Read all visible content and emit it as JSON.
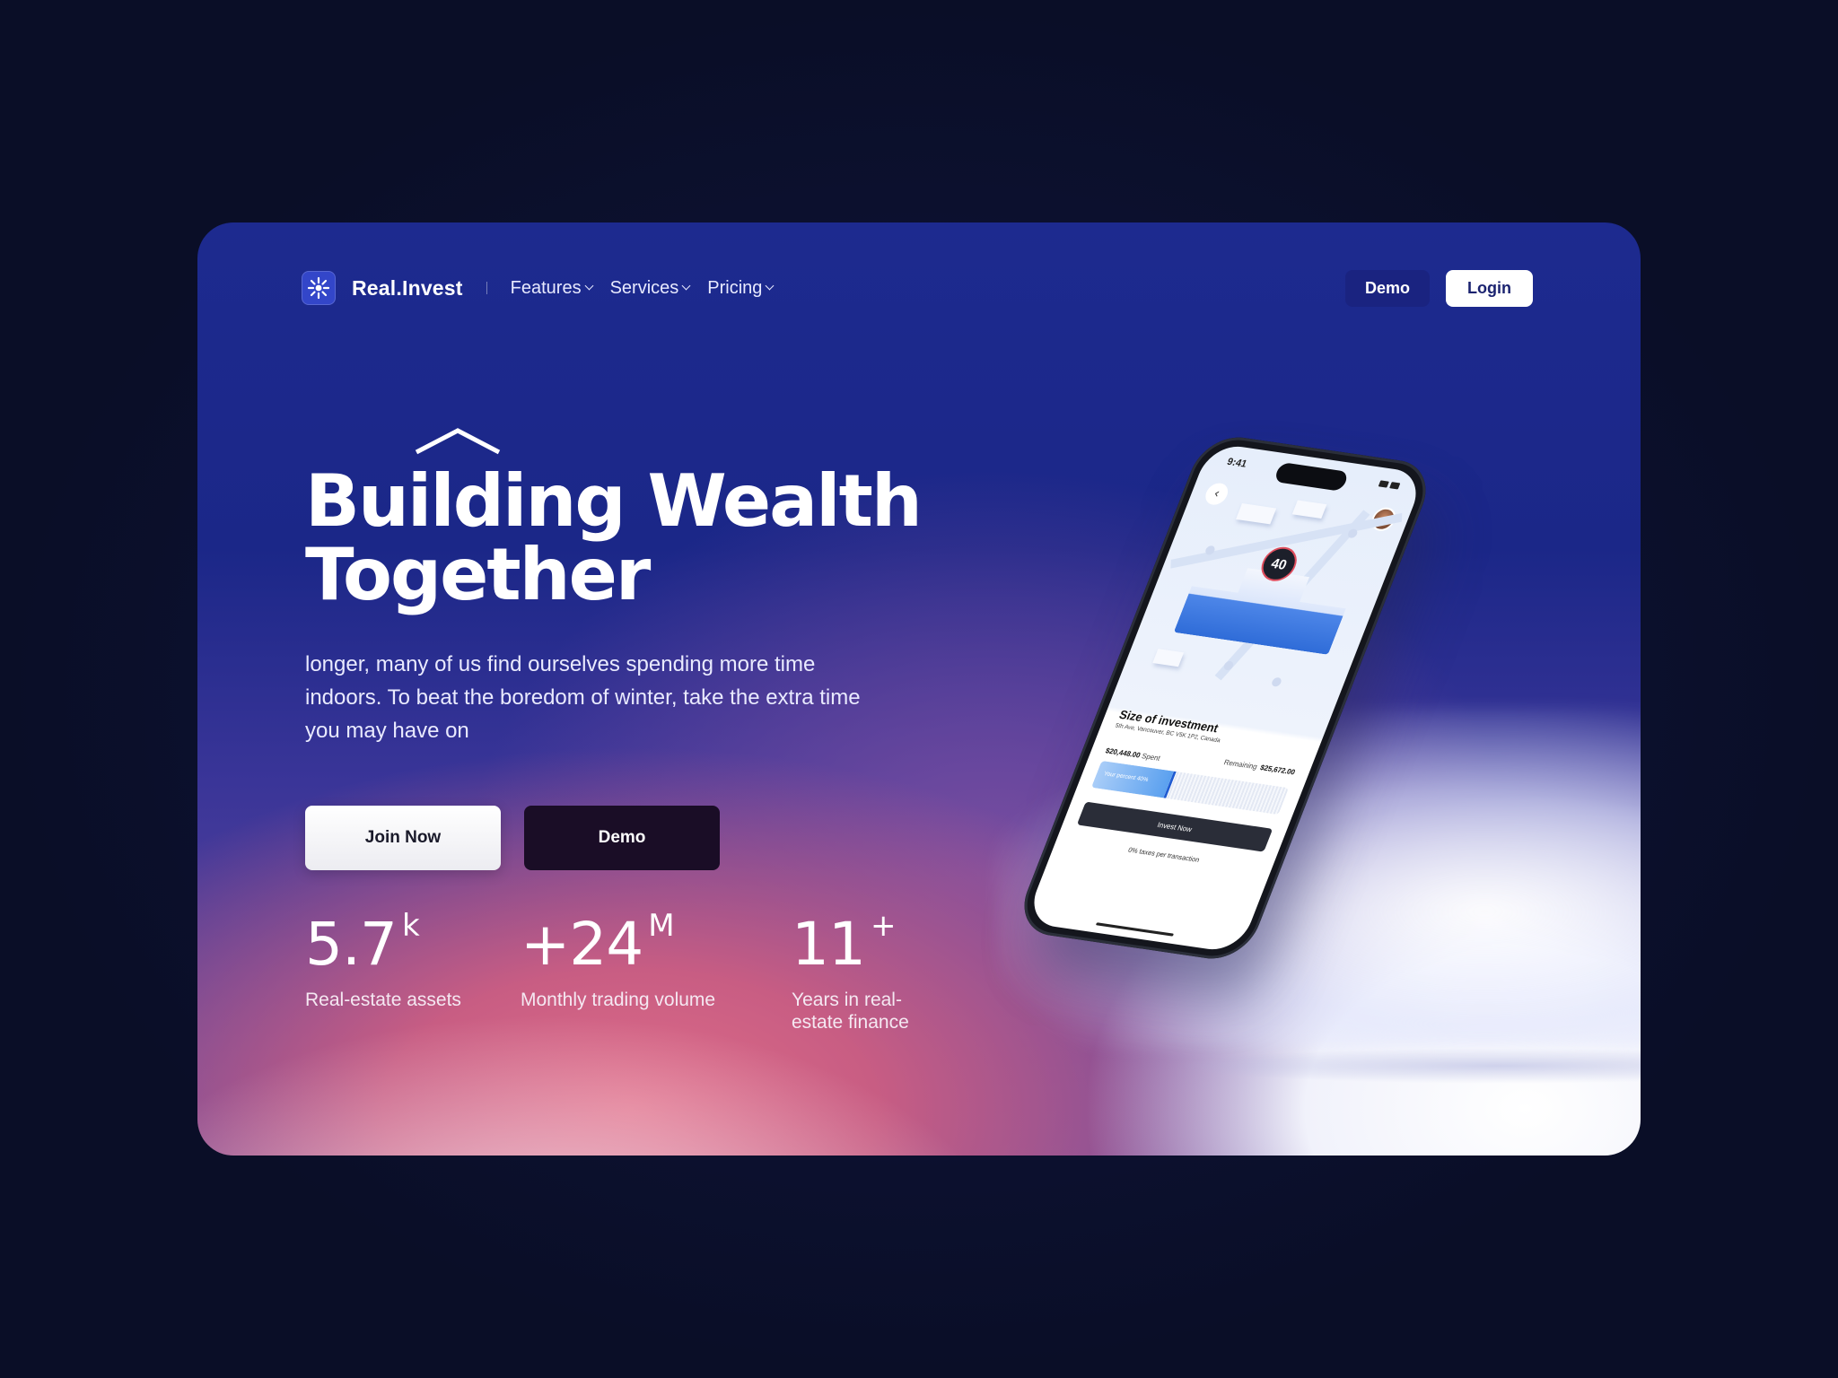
{
  "colors": {
    "page_bg": "#0b0f2b",
    "card_top": "#1d2a8f",
    "card_pink": "#e06d88",
    "logo_bg": "#3346c9",
    "nav_demo_bg": "#1a2380",
    "demo_button_bg": "#1a0d26",
    "accent_blue": "#2f6cd8",
    "badge_ring": "#e04e5e"
  },
  "nav": {
    "logo_icon": "sunburst-logo-icon",
    "brand": "Real.Invest",
    "menu": [
      {
        "label": "Features",
        "icon": "chevron-down-icon"
      },
      {
        "label": "Services",
        "icon": "chevron-down-icon"
      },
      {
        "label": "Pricing",
        "icon": "chevron-down-icon"
      }
    ],
    "demo_label": "Demo",
    "login_label": "Login"
  },
  "hero": {
    "roof_icon": "roof-icon",
    "headline_line1": "Building Wealth",
    "headline_line2": "Together",
    "subtext": "longer, many of us find ourselves spending more time indoors. To beat the boredom of winter, take the extra time you may have on",
    "join_label": "Join Now",
    "demo_label": "Demo"
  },
  "stats": [
    {
      "value": "5.7",
      "suffix": "k",
      "label": "Real-estate assets"
    },
    {
      "value": "+24",
      "suffix": "M",
      "label": "Monthly trading volume"
    },
    {
      "value": "11",
      "suffix": "+",
      "label_line1": "Years in real-",
      "label_line2": "estate finance"
    }
  ],
  "phone": {
    "time": "9:41",
    "badge": "40",
    "title": "Size of investment",
    "address": "5th Ave, Vancouver, BC V5K 1P2, Canada",
    "spent_value": "$20,448.00",
    "spent_label": "Spent",
    "remaining_label": "Remaining",
    "remaining_value": "$25,672.00",
    "percent_label": "Your percent",
    "percent_value": "40%",
    "progress": 0.4,
    "invest_label": "Invest Now",
    "taxes": "0% taxes per transaction"
  }
}
